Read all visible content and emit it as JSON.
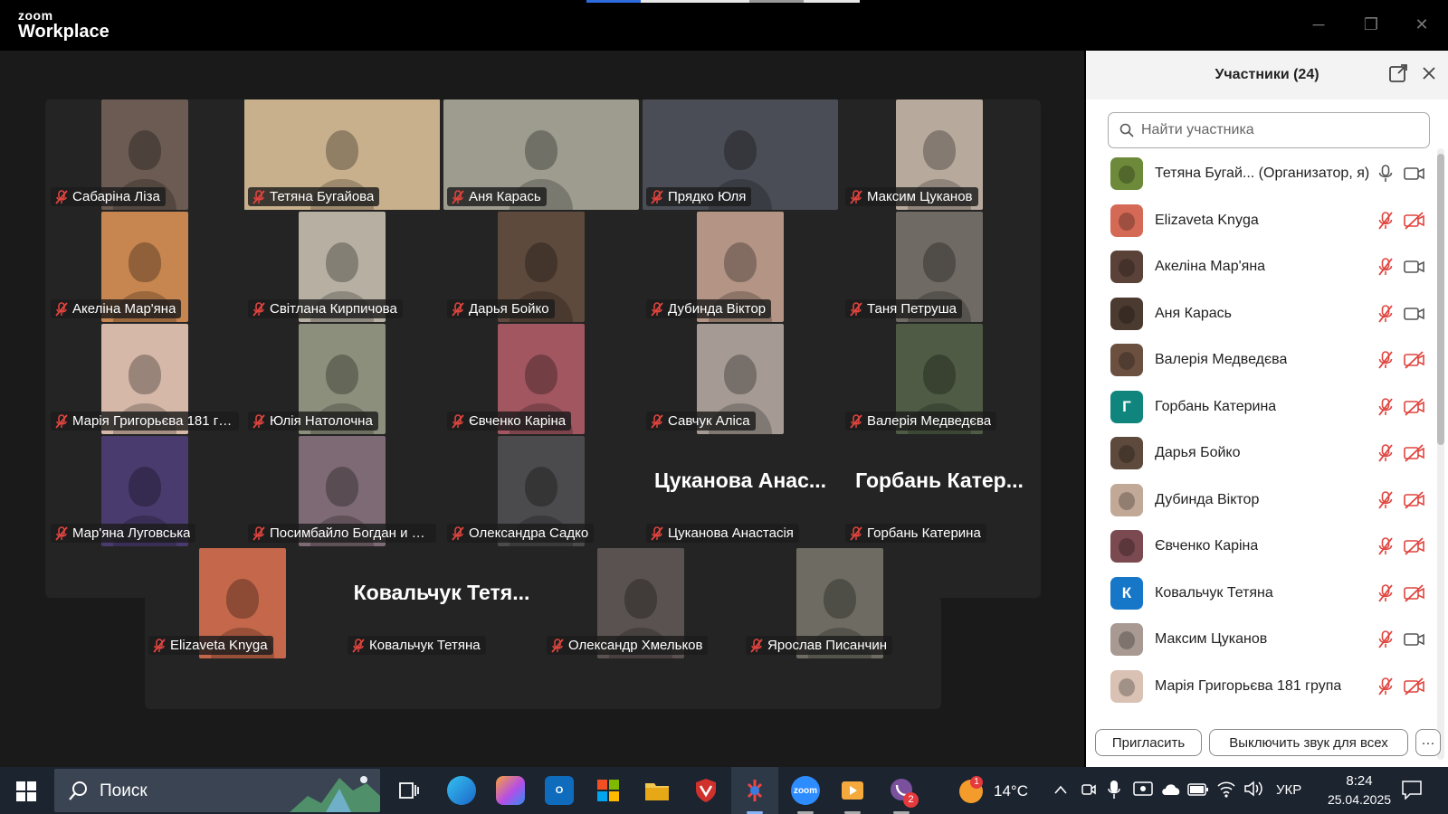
{
  "app": {
    "logo_top": "zoom",
    "logo_bottom": "Workplace"
  },
  "window_controls": {
    "minimize": "─",
    "maximize": "❐",
    "close": "✕"
  },
  "colors": {
    "active_speaker": "#2fd26a",
    "muted_red": "#e0443e",
    "panel_bg": "#ffffff",
    "avatar_teal": "#10857e",
    "avatar_blue": "#1677c8"
  },
  "tiles": [
    {
      "name": "Сабаріна Ліза",
      "photo": "#6b5b52"
    },
    {
      "name": "Тетяна Бугайова",
      "photo": "#c9b08c",
      "active": true,
      "wide": true
    },
    {
      "name": "Аня Карась",
      "photo": "#9d9c8f",
      "wide": true
    },
    {
      "name": "Прядко Юля",
      "photo": "#4a4d55",
      "wide": true
    },
    {
      "name": "Максим Цуканов",
      "photo": "#b8a99d"
    },
    {
      "name": "Акеліна Мар'яна",
      "photo": "#c7854f"
    },
    {
      "name": "Світлана Кирпичова",
      "photo": "#b7b0a2"
    },
    {
      "name": "Дарья Бойко",
      "photo": "#5e4a3c"
    },
    {
      "name": "Дубинда Віктор",
      "photo": "#b49585"
    },
    {
      "name": "Таня Петруша",
      "photo": "#6f6a63"
    },
    {
      "name": "Марія Григорьєва 181 гр...",
      "photo": "#d5b8a8"
    },
    {
      "name": "Юлія Натолочна",
      "photo": "#8c8f7c"
    },
    {
      "name": "Євченко Каріна",
      "photo": "#a15660"
    },
    {
      "name": "Савчук Аліса",
      "photo": "#a59b94"
    },
    {
      "name": "Валерія Медведєва",
      "photo": "#4f5b44"
    },
    {
      "name": "Мар'яна Луговська",
      "photo": "#4a3b6e"
    },
    {
      "name": "Посимбайло Богдан и М...",
      "photo": "#7d6a74"
    },
    {
      "name": "Олександра Садко",
      "photo": "#4b4a4c"
    },
    {
      "name": "Цуканова Анастасія",
      "big": "Цуканова Анас..."
    },
    {
      "name": "Горбань Катерина",
      "big": "Горбань Катер..."
    },
    {
      "name": "Elizaveta Knyga",
      "photo": "#c4674a"
    },
    {
      "name": "Ковальчук Тетяна",
      "big": "Ковальчук Тетя..."
    },
    {
      "name": "Олександр Хмельков",
      "photo": "#5a5250"
    },
    {
      "name": "Ярослав Писанчин",
      "photo": "#6e6c62"
    }
  ],
  "panel": {
    "title": "Участники (24)",
    "search_placeholder": "Найти участника",
    "participants": [
      {
        "name": "Тетяна Бугай... (Организатор, я)",
        "avatar": "#6c8a3a",
        "mic": "on",
        "cam": "on"
      },
      {
        "name": "Elizaveta Knyga",
        "avatar": "#d46a55",
        "mic": "off",
        "cam": "off"
      },
      {
        "name": "Акеліна Мар'яна",
        "avatar": "#5a4238",
        "mic": "off",
        "cam": "on"
      },
      {
        "name": "Аня Карась",
        "avatar": "#4a3a30",
        "mic": "off",
        "cam": "on"
      },
      {
        "name": "Валерія Медведєва",
        "avatar": "#6b5040",
        "mic": "off",
        "cam": "off"
      },
      {
        "name": "Горбань Катерина",
        "initial": "Г",
        "avatar": "#10857e",
        "mic": "off",
        "cam": "off"
      },
      {
        "name": "Дарья Бойко",
        "avatar": "#5e4a3c",
        "mic": "off",
        "cam": "off"
      },
      {
        "name": "Дубинда Віктор",
        "avatar": "#c2a896",
        "mic": "off",
        "cam": "off"
      },
      {
        "name": "Євченко Каріна",
        "avatar": "#7a4a50",
        "mic": "off",
        "cam": "off"
      },
      {
        "name": "Ковальчук Тетяна",
        "initial": "К",
        "avatar": "#1677c8",
        "mic": "off",
        "cam": "off"
      },
      {
        "name": "Максим Цуканов",
        "avatar": "#a89a92",
        "mic": "off",
        "cam": "on"
      },
      {
        "name": "Марія Григорьєва 181 група",
        "avatar": "#d9c2b4",
        "mic": "off",
        "cam": "off"
      }
    ],
    "invite_label": "Пригласить",
    "mute_all_label": "Выключить звук для всех",
    "more_label": "···"
  },
  "taskbar": {
    "search_label": "Поиск",
    "weather_badge": "1",
    "weather_temp": "14°C",
    "lang": "УКР",
    "time": "8:24",
    "date": "25.04.2025",
    "viber_badge": "2",
    "zoom_label": "zoom"
  }
}
